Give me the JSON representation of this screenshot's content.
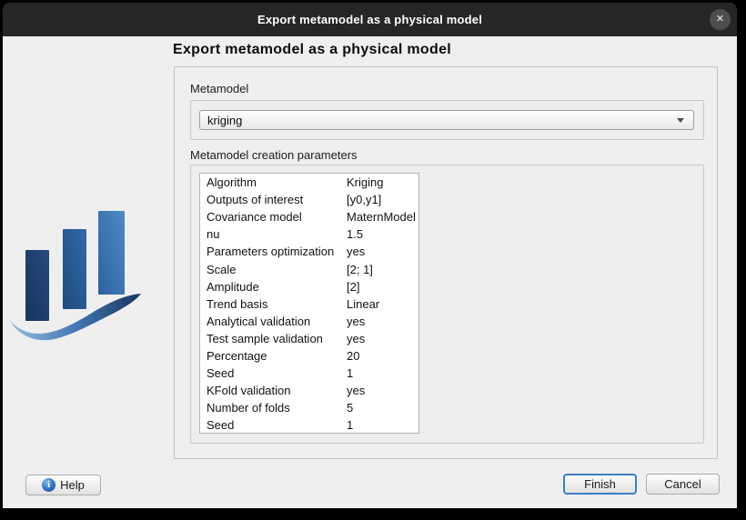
{
  "window": {
    "title": "Export metamodel as a physical model",
    "close_glyph": "✕"
  },
  "dialog": {
    "heading": "Export metamodel as a physical model",
    "metamodel": {
      "label": "Metamodel",
      "selected_value": "kriging"
    },
    "parameters": {
      "label": "Metamodel creation parameters",
      "rows": [
        {
          "name": "Algorithm",
          "value": "Kriging"
        },
        {
          "name": "Outputs of interest",
          "value": "[y0,y1]"
        },
        {
          "name": "Covariance model",
          "value": "MaternModel"
        },
        {
          "name": "nu",
          "value": "1.5"
        },
        {
          "name": "Parameters optimization",
          "value": "yes"
        },
        {
          "name": "Scale",
          "value": "[2; 1]"
        },
        {
          "name": "Amplitude",
          "value": "[2]"
        },
        {
          "name": "Trend basis",
          "value": "Linear"
        },
        {
          "name": "Analytical validation",
          "value": "yes"
        },
        {
          "name": "Test sample validation",
          "value": "yes"
        },
        {
          "name": "Percentage",
          "value": "20"
        },
        {
          "name": "Seed",
          "value": "1"
        },
        {
          "name": "KFold validation",
          "value": "yes"
        },
        {
          "name": "Number of folds",
          "value": "5"
        },
        {
          "name": "Seed",
          "value": "1"
        }
      ]
    }
  },
  "footer": {
    "help_label": "Help",
    "help_icon_glyph": "i",
    "finish_label": "Finish",
    "cancel_label": "Cancel"
  },
  "colors": {
    "titlebar": "#262626",
    "content_background": "#efefef",
    "default_button_border": "#3a7fc2",
    "logo_bar_dark": "#1d3f6f",
    "logo_bar_mid": "#2b5d99",
    "logo_bar_light": "#3e7cba"
  }
}
